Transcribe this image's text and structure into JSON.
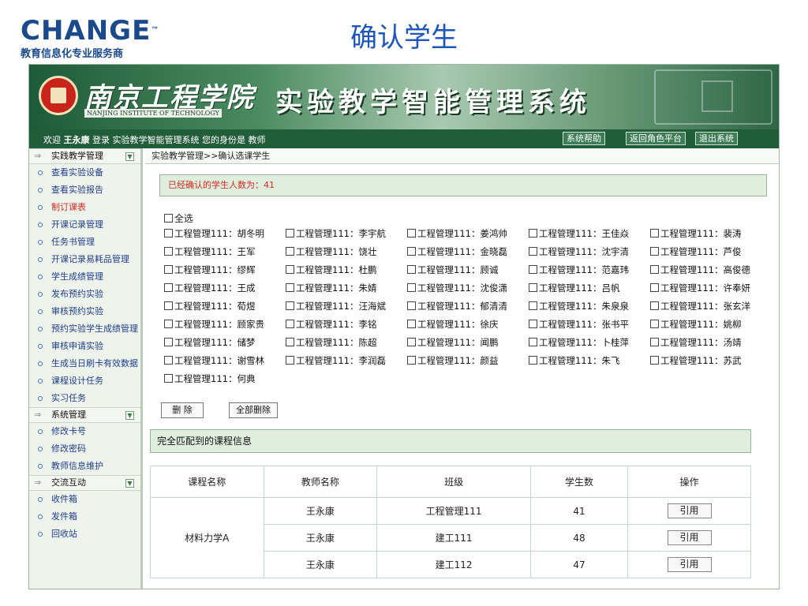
{
  "slide": {
    "brand_logo": "CHANGE",
    "brand_tm": "™",
    "brand_sub": "教育信息化专业服务商",
    "title": "确认学生"
  },
  "banner": {
    "college_cn": "南京工程学院",
    "college_en": "NANJING INSTITUTE OF TECHNOLOGY",
    "system_title": "实验教学智能管理系统"
  },
  "topbar": {
    "welcome_prefix": "欢迎",
    "user_name": "王永康",
    "welcome_suffix": "登录 实验教学智能管理系统 您的身份是 教师",
    "help": "系统帮助",
    "role": "返回角色平台",
    "exit": "退出系统"
  },
  "sidebar": {
    "groups": [
      {
        "label": "实践教学管理",
        "items": [
          "查看实验设备",
          "查看实验报告",
          "制订课表",
          "开课记录管理",
          "任务书管理",
          "开课记录易耗品管理",
          "学生成绩管理",
          "发布预约实验",
          "审核预约实验",
          "预约实验学生成绩管理",
          "审核申请实验",
          "生成当日刷卡有效数据",
          "课程设计任务",
          "实习任务"
        ]
      },
      {
        "label": "系统管理",
        "items": [
          "修改卡号",
          "修改密码",
          "教师信息维护"
        ]
      },
      {
        "label": "交流互动",
        "items": [
          "收件箱",
          "发件箱",
          "回收站"
        ]
      }
    ],
    "active_item": "制订课表"
  },
  "main": {
    "breadcrumb": "实验教学管理>>确认选课学生",
    "confirmed_label": "已经确认的学生人数为：",
    "confirmed_count": "41",
    "select_all": "全选",
    "students": [
      [
        "工程管理111：胡冬明",
        "工程管理111：李宇航",
        "工程管理111：姜鸿帅",
        "工程管理111：王佳焱",
        "工程管理111：裴涛"
      ],
      [
        "工程管理111：王军",
        "工程管理111：饶壮",
        "工程管理111：金晓磊",
        "工程管理111：沈宇清",
        "工程管理111：芦俊"
      ],
      [
        "工程管理111：缪辉",
        "工程管理111：杜鹏",
        "工程管理111：顾诚",
        "工程管理111：范嘉玮",
        "工程管理111：高俊德"
      ],
      [
        "工程管理111：王成",
        "工程管理111：朱婧",
        "工程管理111：沈俊潇",
        "工程管理111：吕帆",
        "工程管理111：许奉妍"
      ],
      [
        "工程管理111：荀煜",
        "工程管理111：汪海斌",
        "工程管理111：郁清清",
        "工程管理111：朱泉泉",
        "工程管理111：张玄洋"
      ],
      [
        "工程管理111：顾家贵",
        "工程管理111：李铭",
        "工程管理111：徐庆",
        "工程管理111：张书平",
        "工程管理111：姚柳"
      ],
      [
        "工程管理111：储梦",
        "工程管理111：陈超",
        "工程管理111：闻鹏",
        "工程管理111：卜桂萍",
        "工程管理111：汤靖"
      ],
      [
        "工程管理111：谢雪林",
        "工程管理111：李润磊",
        "工程管理111：颜益",
        "工程管理111：朱飞",
        "工程管理111：苏武"
      ],
      [
        "工程管理111：何典"
      ]
    ],
    "delete_btn": "删 除",
    "delete_all_btn": "全部删除",
    "matched_title": "完全匹配到的课程信息",
    "table": {
      "headers": [
        "课程名称",
        "教师名称",
        "班级",
        "学生数",
        "操作"
      ],
      "course_name": "材料力学A",
      "rows": [
        {
          "teacher": "王永康",
          "class": "工程管理111",
          "count": "41",
          "action": "引用"
        },
        {
          "teacher": "王永康",
          "class": "建工111",
          "count": "48",
          "action": "引用"
        },
        {
          "teacher": "王永康",
          "class": "建工112",
          "count": "47",
          "action": "引用"
        }
      ]
    }
  }
}
